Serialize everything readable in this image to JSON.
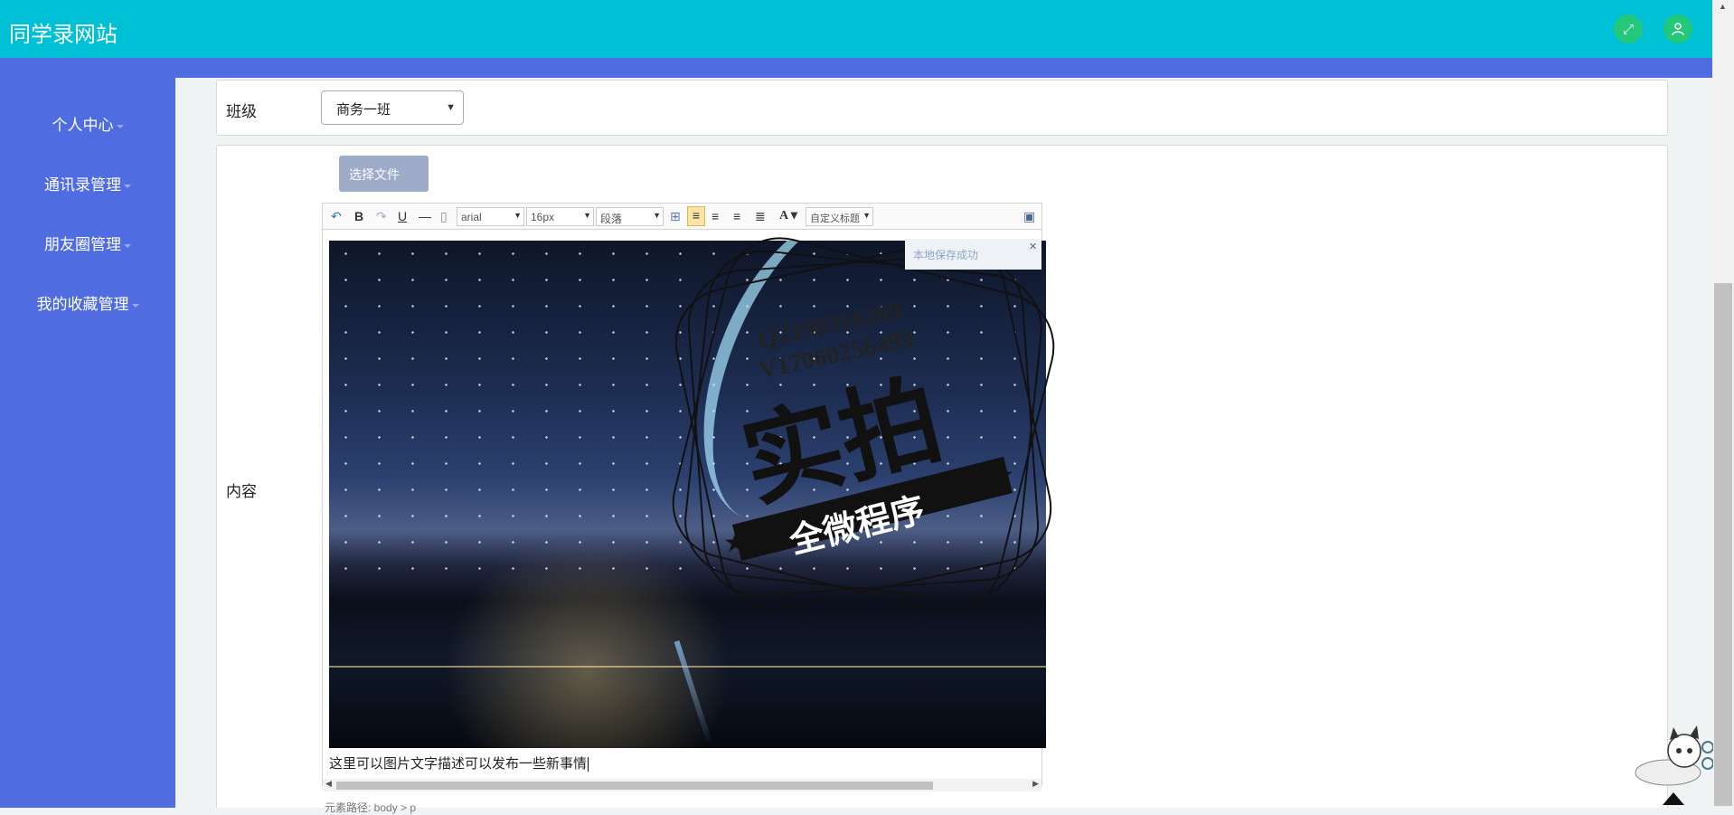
{
  "header": {
    "site_title": "同学录网站",
    "fullscreen_icon": "expand-icon",
    "user_icon": "user-icon",
    "bg_color": "#00c0d5",
    "button_color": "#23c87a"
  },
  "sidebar": {
    "bg_color": "#4f6de0",
    "items": [
      {
        "label": "个人中心"
      },
      {
        "label": "通讯录管理"
      },
      {
        "label": "朋友圈管理"
      },
      {
        "label": "我的收藏管理"
      }
    ]
  },
  "form": {
    "class_label": "班级",
    "class_selected": "商务一班",
    "content_label": "内容",
    "file_button": "选择文件"
  },
  "editor": {
    "toolbar": {
      "font_family": "arial",
      "font_size": "16px",
      "paragraph": "段落",
      "custom_title": "自定义标题",
      "icons": [
        "undo-icon",
        "bold-icon",
        "redo-icon",
        "underline-icon",
        "horizontal-rule-icon",
        "blank-page-icon",
        "table-icon",
        "align-left-icon",
        "align-right-icon",
        "align-center-icon",
        "align-justify-icon",
        "font-color-icon",
        "preview-icon"
      ]
    },
    "toast": "本地保存成功",
    "watermark": {
      "qq": "Q2196316269",
      "wechat": "V17060256499",
      "main": "实拍",
      "ribbon": "全微程序"
    },
    "caption": "这里可以图片文字描述可以发布一些新事情",
    "element_path": "元素路径: body > p"
  }
}
